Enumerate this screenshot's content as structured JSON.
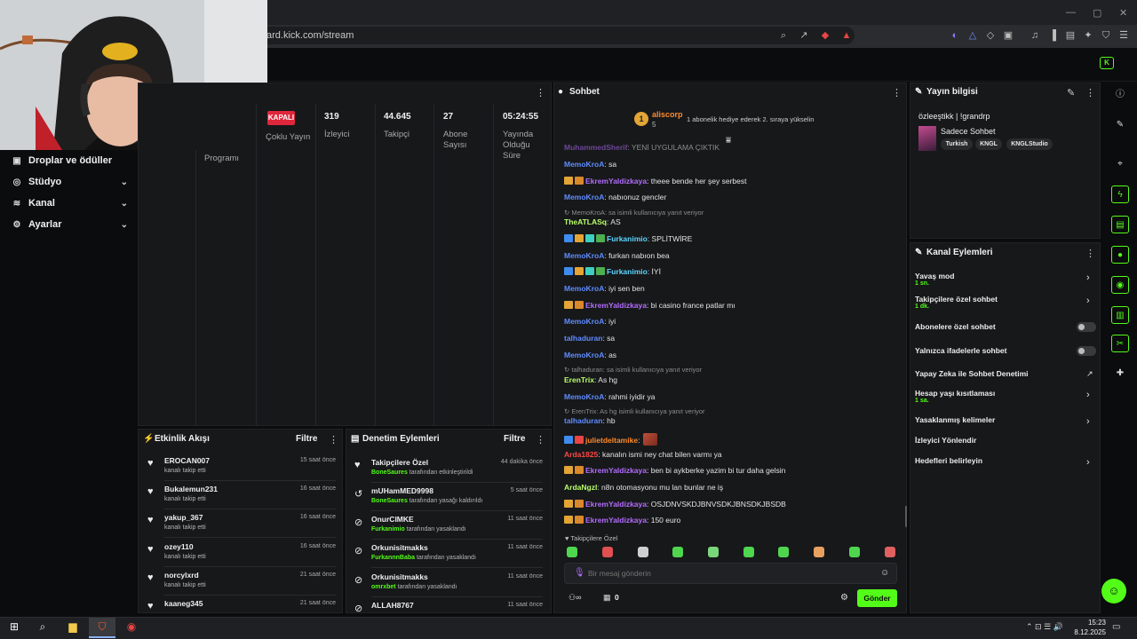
{
  "browser": {
    "url": "ard.kick.com/stream",
    "window_controls": [
      "—",
      "▢",
      "✕"
    ]
  },
  "sidebar": {
    "items": [
      {
        "label": "Droplar ve ödüller",
        "icon": "gift-icon",
        "glyph": "▣",
        "chevron": false
      },
      {
        "label": "Stüdyo",
        "icon": "studio-icon",
        "glyph": "◎",
        "chevron": true
      },
      {
        "label": "Kanal",
        "icon": "channel-icon",
        "glyph": "≋",
        "chevron": true
      },
      {
        "label": "Ayarlar",
        "icon": "gear-icon",
        "glyph": "⚙",
        "chevron": true
      }
    ],
    "chevron": "⌄"
  },
  "stats": {
    "status_badge": "KAPALI",
    "status_label": "Çoklu Yayın",
    "program_label": "Programı",
    "viewers": {
      "value": "319",
      "label": "İzleyici"
    },
    "followers": {
      "value": "44.645",
      "label": "Takipçi"
    },
    "subs": {
      "value": "27",
      "label": "Abone Sayısı"
    },
    "uptime": {
      "value": "05:24:55",
      "label": "Yayında Olduğu Süre"
    }
  },
  "chat": {
    "title": "Sohbet",
    "pinned_user": "aliscorp",
    "pinned_count": "5",
    "pinned_rank": "1",
    "pinned_text": "1 abonelik hediye ederek 2. sıraya yükselin",
    "lines": [
      {
        "user": "MuhammedSherif",
        "cls": "u-purple",
        "text": ": YENİ UYGULAMA ÇIKTIK",
        "badges": []
      },
      {
        "user": "MemoKroA",
        "cls": "u-blue",
        "text": ": sa",
        "badges": []
      },
      {
        "user": "EkremYaldizkaya",
        "cls": "u-purple",
        "text": ": theee bende her şey serbest",
        "badges": [
          "#e2a536",
          "#d9882b"
        ]
      },
      {
        "user": "MemoKroA",
        "cls": "u-blue",
        "text": ": nabıonuz gencler",
        "badges": []
      },
      {
        "reply": "↻ MemoKroA: sa isimli kullanıcıya yanıt veriyor"
      },
      {
        "user": "TheATLASq",
        "cls": "u-lime",
        "text": ": AS",
        "badges": []
      },
      {
        "user": "Furkanimio",
        "cls": "u-cyan",
        "text": ": SPLİTWİRE",
        "badges": [
          "#3f8cf0",
          "#e2a536",
          "#3dd0c0",
          "#4caf50"
        ]
      },
      {
        "user": "MemoKroA",
        "cls": "u-blue",
        "text": ": furkan nabıon bea",
        "badges": []
      },
      {
        "user": "Furkanimio",
        "cls": "u-cyan",
        "text": ": İYİ",
        "badges": [
          "#3f8cf0",
          "#e2a536",
          "#3dd0c0",
          "#4caf50"
        ]
      },
      {
        "user": "MemoKroA",
        "cls": "u-blue",
        "text": ": iyi sen ben",
        "badges": []
      },
      {
        "user": "EkremYaldizkaya",
        "cls": "u-purple",
        "text": ": bi casino france patlar mı",
        "badges": [
          "#e2a536",
          "#d9882b"
        ]
      },
      {
        "user": "MemoKroA",
        "cls": "u-blue",
        "text": ": iyi",
        "badges": []
      },
      {
        "user": "talhaduran",
        "cls": "u-blue",
        "text": ": sa",
        "badges": []
      },
      {
        "user": "MemoKroA",
        "cls": "u-blue",
        "text": ": as",
        "badges": []
      },
      {
        "reply": "↻ talhaduran: sa isimli kullanıcıya yanıt veriyor"
      },
      {
        "user": "ErenTrix",
        "cls": "u-lime",
        "text": ": As hg",
        "badges": []
      },
      {
        "user": "MemoKroA",
        "cls": "u-blue",
        "text": ": rahmi iyidir ya",
        "badges": []
      },
      {
        "reply": "↻ ErenTrix: As hg isimli kullanıcıya yanıt veriyor"
      },
      {
        "user": "talhaduran",
        "cls": "u-blue",
        "text": ": hb",
        "badges": []
      },
      {
        "user": "julietdeltamike",
        "cls": "u-orange",
        "text": ":",
        "badges": [
          "#3f8cf0",
          "#e84545"
        ]
      },
      {
        "user": "Arda1825",
        "cls": "u-red",
        "text": ": kanalın ismi ney chat bilen varmı ya",
        "badges": []
      },
      {
        "user": "EkremYaldizkaya",
        "cls": "u-purple",
        "text": ": ben bi aykberke yazim bi tur daha gelsin",
        "badges": [
          "#e2a536",
          "#d9882b"
        ]
      },
      {
        "user": "ArdaNgzl",
        "cls": "u-lime",
        "text": ": n8n otomasyonu mu lan bunlar ne iş",
        "badges": []
      },
      {
        "user": "EkremYaldizkaya",
        "cls": "u-purple",
        "text": ": OSJDNVSKDJBNVSDKJBNSDKJBSDB",
        "badges": [
          "#e2a536",
          "#d9882b"
        ]
      },
      {
        "user": "EkremYaldizkaya",
        "cls": "u-purple",
        "text": ": 150 euro",
        "badges": [
          "#e2a536",
          "#d9882b"
        ]
      }
    ],
    "emote_label": "♥ Takipçilere Özel",
    "input_placeholder": "Bir mesaj gönderin",
    "points": "0",
    "send_label": "Gönder"
  },
  "stream_info": {
    "title": "Yayın bilgisi",
    "stream_title": "özleeştikk | !grandrp",
    "category": "Sadece Sohbet",
    "tags": [
      "Turkish",
      "KNGL",
      "KNGLStudio"
    ]
  },
  "channel_actions": {
    "title": "Kanal Eylemleri",
    "rows": [
      {
        "label": "Yavaş mod",
        "sub": "1 sn.",
        "control": "chevron"
      },
      {
        "label": "Takipçilere özel sohbet",
        "sub": "1 dk.",
        "control": "chevron"
      },
      {
        "label": "Abonelere özel sohbet",
        "sub": "",
        "control": "toggle"
      },
      {
        "label": "Yalnızca ifadelerle sohbet",
        "sub": "",
        "control": "toggle"
      },
      {
        "label": "Yapay Zeka ile Sohbet Denetimi",
        "sub": "",
        "control": "external"
      },
      {
        "label": "Hesap yaşı kısıtlaması",
        "sub": "1 sa.",
        "control": "chevron"
      },
      {
        "label": "Yasaklanmış kelimeler",
        "sub": "",
        "control": "chevron"
      },
      {
        "label": "İzleyici Yönlendir",
        "sub": "",
        "control": "none"
      },
      {
        "label": "Hedefleri belirleyin",
        "sub": "",
        "control": "chevron"
      }
    ]
  },
  "activity_feed": {
    "title": "Etkinlik Akışı",
    "filter": "Filtre",
    "items": [
      {
        "name": "EROCAN007",
        "sub": "kanalı takip etti",
        "time": "15 saat önce"
      },
      {
        "name": "Bukalemun231",
        "sub": "kanalı takip etti",
        "time": "16 saat önce"
      },
      {
        "name": "yakup_367",
        "sub": "kanalı takip etti",
        "time": "16 saat önce"
      },
      {
        "name": "ozey110",
        "sub": "kanalı takip etti",
        "time": "16 saat önce"
      },
      {
        "name": "norcylxrd",
        "sub": "kanalı takip etti",
        "time": "21 saat önce"
      },
      {
        "name": "kaaneg345",
        "sub": "",
        "time": "21 saat önce"
      }
    ]
  },
  "mod_actions": {
    "title": "Denetim Eylemleri",
    "filter": "Filtre",
    "items": [
      {
        "name": "Takipçilere Özel",
        "by": "BoneSaures",
        "sub": " tarafından etkinleştirildi",
        "time": "44 dakika önce",
        "icon": "heart-icon",
        "glyph": "♥"
      },
      {
        "name": "mUHamMED9998",
        "by": "BoneSaures",
        "sub": " tarafından yasağı kaldırıldı",
        "time": "5 saat önce",
        "icon": "undo-icon",
        "glyph": "↺"
      },
      {
        "name": "OnurCIMKE",
        "by": "Furkanimio",
        "sub": " tarafından yasaklandı",
        "time": "11 saat önce",
        "icon": "ban-icon",
        "glyph": "⊘"
      },
      {
        "name": "Orkunisitmakks",
        "by": "FurkannnBaba",
        "sub": " tarafından yasaklandı",
        "time": "11 saat önce",
        "icon": "ban-icon",
        "glyph": "⊘"
      },
      {
        "name": "Orkunisitmakks",
        "by": "omrxbet",
        "sub": " tarafından yasaklandı",
        "time": "11 saat önce",
        "icon": "ban-icon",
        "glyph": "⊘"
      },
      {
        "name": "ALLAH8767",
        "by": "",
        "sub": "",
        "time": "11 saat önce",
        "icon": "ban-icon",
        "glyph": "⊘"
      }
    ]
  },
  "taskbar": {
    "time": "15:23",
    "date": "8.12.2025"
  },
  "colors": {
    "accent": "#53fc18",
    "panel": "#17181a",
    "background": "#0b0c0d"
  }
}
